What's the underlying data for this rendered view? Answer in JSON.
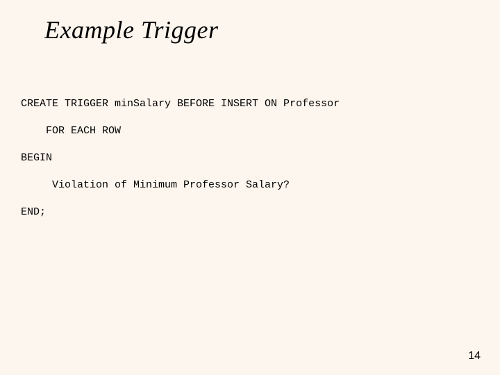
{
  "slide": {
    "title": "Example Trigger",
    "code": {
      "line1": "CREATE TRIGGER minSalary BEFORE INSERT ON Professor",
      "line2": "    FOR EACH ROW",
      "line3": "BEGIN",
      "line4": "     Violation of Minimum Professor Salary?",
      "line5": "END;"
    },
    "page_number": "14"
  }
}
